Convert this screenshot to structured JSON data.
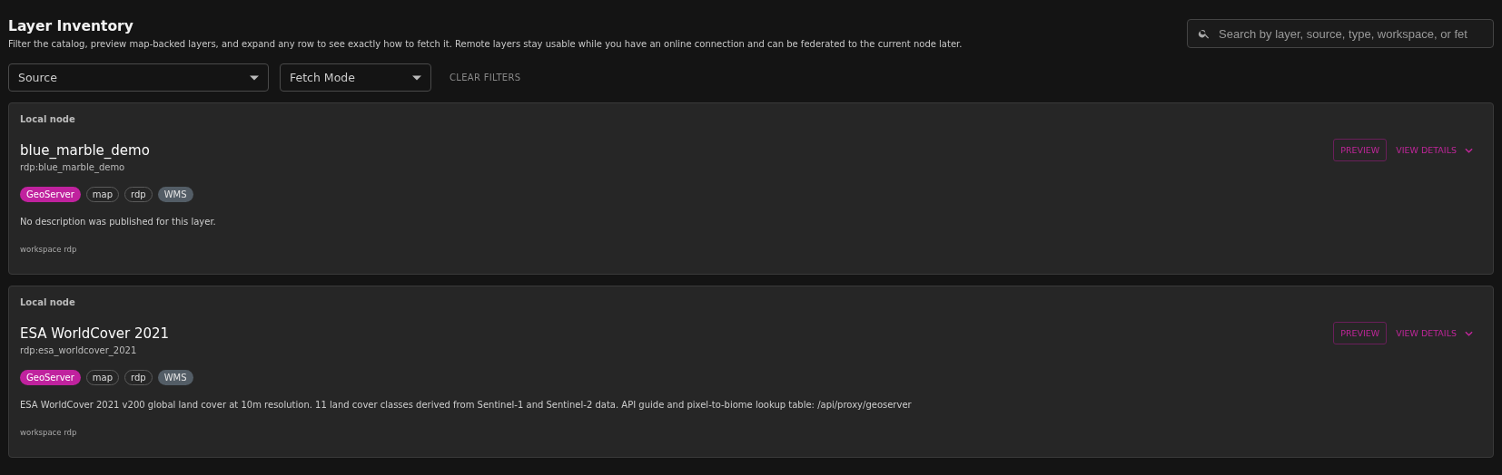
{
  "header": {
    "title": "Layer Inventory",
    "subtitle": "Filter the catalog, preview map-backed layers, and expand any row to see exactly how to fetch it. Remote layers stay usable while you have an online connection and can be federated to the current node later."
  },
  "search": {
    "placeholder": "Search by layer, source, type, workspace, or fet"
  },
  "filters": [
    {
      "placeholder": "Source"
    },
    {
      "placeholder": "Fetch Mode"
    }
  ],
  "clear_filters": "CLEAR FILTERS",
  "layers": [
    {
      "node": "Local node",
      "title": "blue_marble_demo",
      "id": "rdp:blue_marble_demo",
      "tags": [
        {
          "label": "GeoServer",
          "kind": "source"
        },
        {
          "label": "map",
          "kind": "plain"
        },
        {
          "label": "rdp",
          "kind": "plain"
        },
        {
          "label": "WMS",
          "kind": "type"
        }
      ],
      "description": "No description was published for this layer.",
      "workspace": "workspace rdp",
      "preview": "PREVIEW",
      "details": "VIEW DETAILS",
      "expanded": false
    },
    {
      "node": "Local node",
      "title": "ESA WorldCover 2021",
      "id": "rdp:esa_worldcover_2021",
      "tags": [
        {
          "label": "GeoServer",
          "kind": "source"
        },
        {
          "label": "map",
          "kind": "plain"
        },
        {
          "label": "rdp",
          "kind": "plain"
        },
        {
          "label": "WMS",
          "kind": "type"
        }
      ],
      "description": "ESA WorldCover 2021 v200 global land cover at 10m resolution. 11 land cover classes derived from Sentinel-1 and Sentinel-2 data. API guide and pixel-to-biome lookup table: /api/proxy/geoserver",
      "workspace": "workspace rdp",
      "preview": "PREVIEW",
      "details": "VIEW DETAILS",
      "expanded": false
    }
  ]
}
